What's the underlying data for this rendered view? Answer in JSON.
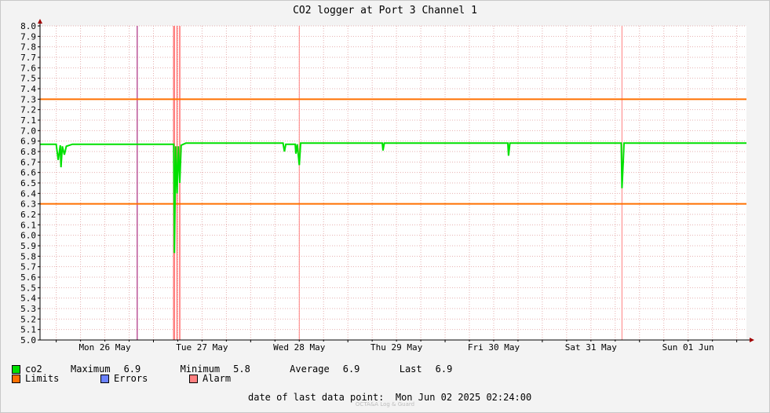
{
  "title": "CO2 logger at Port 3 Channel 1",
  "chart_data": {
    "type": "line",
    "ylim": [
      5.0,
      8.0
    ],
    "y_ticks": [
      "5.0",
      "5.1",
      "5.2",
      "5.3",
      "5.4",
      "5.5",
      "5.6",
      "5.7",
      "5.8",
      "5.9",
      "6.0",
      "6.1",
      "6.2",
      "6.3",
      "6.4",
      "6.5",
      "6.6",
      "6.7",
      "6.8",
      "6.9",
      "7.0",
      "7.1",
      "7.2",
      "7.3",
      "7.4",
      "7.5",
      "7.6",
      "7.7",
      "7.8",
      "7.9",
      "8.0"
    ],
    "x_range": [
      "2025-05-25 20:00",
      "2025-06-02 02:24"
    ],
    "x_tick_labels": [
      {
        "label": "Mon 26 May",
        "x": "2025-05-26 12:00"
      },
      {
        "label": "Tue 27 May",
        "x": "2025-05-27 12:00"
      },
      {
        "label": "Wed 28 May",
        "x": "2025-05-28 12:00"
      },
      {
        "label": "Thu 29 May",
        "x": "2025-05-29 12:00"
      },
      {
        "label": "Fri 30 May",
        "x": "2025-05-30 12:00"
      },
      {
        "label": "Sat 31 May",
        "x": "2025-05-31 12:00"
      },
      {
        "label": "Sun 01 Jun",
        "x": "2025-06-01 12:00"
      }
    ],
    "grid": true,
    "limits": [
      7.3,
      6.3
    ],
    "series": [
      {
        "name": "co2",
        "color": "#00e000",
        "points": [
          [
            "2025-05-25 20:00",
            6.87
          ],
          [
            "2025-05-26 00:00",
            6.87
          ],
          [
            "2025-05-26 00:30",
            6.72
          ],
          [
            "2025-05-26 01:00",
            6.86
          ],
          [
            "2025-05-26 01:10",
            6.65
          ],
          [
            "2025-05-26 01:30",
            6.85
          ],
          [
            "2025-05-26 02:00",
            6.77
          ],
          [
            "2025-05-26 02:30",
            6.85
          ],
          [
            "2025-05-26 04:00",
            6.87
          ],
          [
            "2025-05-27 00:00",
            6.87
          ],
          [
            "2025-05-27 05:00",
            6.87
          ],
          [
            "2025-05-27 05:10",
            5.83
          ],
          [
            "2025-05-27 05:30",
            6.85
          ],
          [
            "2025-05-27 05:50",
            6.4
          ],
          [
            "2025-05-27 06:10",
            6.85
          ],
          [
            "2025-05-27 06:30",
            6.5
          ],
          [
            "2025-05-27 06:50",
            6.86
          ],
          [
            "2025-05-27 08:00",
            6.88
          ],
          [
            "2025-05-28 00:00",
            6.88
          ],
          [
            "2025-05-28 08:00",
            6.88
          ],
          [
            "2025-05-28 08:20",
            6.8
          ],
          [
            "2025-05-28 08:40",
            6.87
          ],
          [
            "2025-05-28 11:00",
            6.87
          ],
          [
            "2025-05-28 11:10",
            6.78
          ],
          [
            "2025-05-28 11:30",
            6.87
          ],
          [
            "2025-05-28 12:00",
            6.67
          ],
          [
            "2025-05-28 12:20",
            6.88
          ],
          [
            "2025-05-29 00:00",
            6.88
          ],
          [
            "2025-05-29 08:30",
            6.88
          ],
          [
            "2025-05-29 08:40",
            6.81
          ],
          [
            "2025-05-29 09:00",
            6.88
          ],
          [
            "2025-05-30 15:30",
            6.88
          ],
          [
            "2025-05-30 15:40",
            6.76
          ],
          [
            "2025-05-30 16:00",
            6.88
          ],
          [
            "2025-05-31 19:30",
            6.88
          ],
          [
            "2025-05-31 19:40",
            6.45
          ],
          [
            "2025-05-31 20:00",
            6.72
          ],
          [
            "2025-05-31 20:10",
            6.88
          ],
          [
            "2025-06-01 12:00",
            6.88
          ],
          [
            "2025-06-02 02:24",
            6.88
          ]
        ]
      }
    ],
    "events": [
      {
        "type": "boundary",
        "color": "#990066",
        "x": "2025-05-26 20:00"
      },
      {
        "type": "alarm",
        "color": "#ff8080",
        "ranges": [
          [
            "2025-05-27 04:50",
            "2025-05-27 05:20"
          ],
          [
            "2025-05-27 05:40",
            "2025-05-27 06:00"
          ],
          [
            "2025-05-27 06:20",
            "2025-05-27 06:40"
          ]
        ]
      },
      {
        "type": "alarm-line",
        "color": "#ff8080",
        "x": "2025-05-28 12:00"
      },
      {
        "type": "alarm-line",
        "color": "#ff8080",
        "x": "2025-05-31 19:40"
      }
    ]
  },
  "legend": {
    "series": {
      "label": "co2",
      "color": "#00e000"
    },
    "stats": {
      "max_label": "Maximum",
      "max_value": "6.9",
      "min_label": "Minimum",
      "min_value": "5.8",
      "avg_label": "Average",
      "avg_value": "6.9",
      "last_label": "Last",
      "last_value": "6.9"
    },
    "limits": {
      "label": "Limits",
      "color": "#ff7000"
    },
    "errors": {
      "label": "Errors",
      "color": "#6b82ff"
    },
    "alarm": {
      "label": "Alarm",
      "color": "#ff8080"
    }
  },
  "footer": {
    "label": "date of last data point:",
    "value": "Mon Jun 02 2025 02:24:00"
  },
  "watermark": "OCTA&A Log & Guard"
}
